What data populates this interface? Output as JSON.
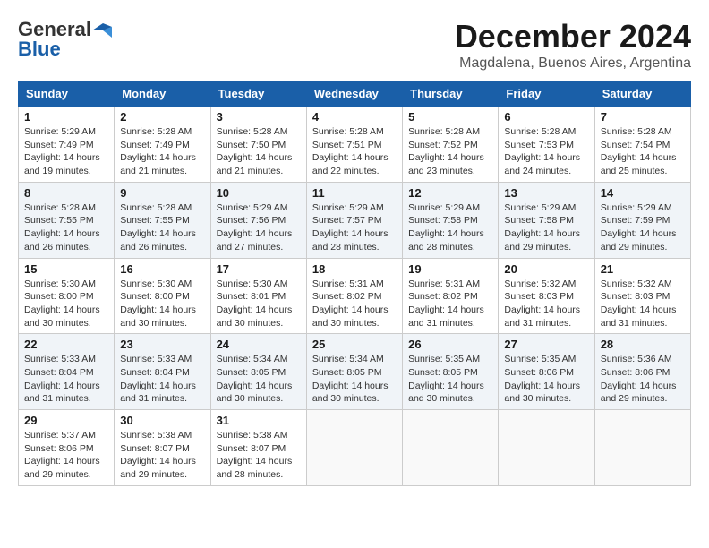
{
  "logo": {
    "general": "General",
    "blue": "Blue"
  },
  "title": {
    "month": "December 2024",
    "location": "Magdalena, Buenos Aires, Argentina"
  },
  "weekdays": [
    "Sunday",
    "Monday",
    "Tuesday",
    "Wednesday",
    "Thursday",
    "Friday",
    "Saturday"
  ],
  "weeks": [
    [
      {
        "day": "1",
        "info": "Sunrise: 5:29 AM\nSunset: 7:49 PM\nDaylight: 14 hours\nand 19 minutes."
      },
      {
        "day": "2",
        "info": "Sunrise: 5:28 AM\nSunset: 7:49 PM\nDaylight: 14 hours\nand 21 minutes."
      },
      {
        "day": "3",
        "info": "Sunrise: 5:28 AM\nSunset: 7:50 PM\nDaylight: 14 hours\nand 21 minutes."
      },
      {
        "day": "4",
        "info": "Sunrise: 5:28 AM\nSunset: 7:51 PM\nDaylight: 14 hours\nand 22 minutes."
      },
      {
        "day": "5",
        "info": "Sunrise: 5:28 AM\nSunset: 7:52 PM\nDaylight: 14 hours\nand 23 minutes."
      },
      {
        "day": "6",
        "info": "Sunrise: 5:28 AM\nSunset: 7:53 PM\nDaylight: 14 hours\nand 24 minutes."
      },
      {
        "day": "7",
        "info": "Sunrise: 5:28 AM\nSunset: 7:54 PM\nDaylight: 14 hours\nand 25 minutes."
      }
    ],
    [
      {
        "day": "8",
        "info": "Sunrise: 5:28 AM\nSunset: 7:55 PM\nDaylight: 14 hours\nand 26 minutes."
      },
      {
        "day": "9",
        "info": "Sunrise: 5:28 AM\nSunset: 7:55 PM\nDaylight: 14 hours\nand 26 minutes."
      },
      {
        "day": "10",
        "info": "Sunrise: 5:29 AM\nSunset: 7:56 PM\nDaylight: 14 hours\nand 27 minutes."
      },
      {
        "day": "11",
        "info": "Sunrise: 5:29 AM\nSunset: 7:57 PM\nDaylight: 14 hours\nand 28 minutes."
      },
      {
        "day": "12",
        "info": "Sunrise: 5:29 AM\nSunset: 7:58 PM\nDaylight: 14 hours\nand 28 minutes."
      },
      {
        "day": "13",
        "info": "Sunrise: 5:29 AM\nSunset: 7:58 PM\nDaylight: 14 hours\nand 29 minutes."
      },
      {
        "day": "14",
        "info": "Sunrise: 5:29 AM\nSunset: 7:59 PM\nDaylight: 14 hours\nand 29 minutes."
      }
    ],
    [
      {
        "day": "15",
        "info": "Sunrise: 5:30 AM\nSunset: 8:00 PM\nDaylight: 14 hours\nand 30 minutes."
      },
      {
        "day": "16",
        "info": "Sunrise: 5:30 AM\nSunset: 8:00 PM\nDaylight: 14 hours\nand 30 minutes."
      },
      {
        "day": "17",
        "info": "Sunrise: 5:30 AM\nSunset: 8:01 PM\nDaylight: 14 hours\nand 30 minutes."
      },
      {
        "day": "18",
        "info": "Sunrise: 5:31 AM\nSunset: 8:02 PM\nDaylight: 14 hours\nand 30 minutes."
      },
      {
        "day": "19",
        "info": "Sunrise: 5:31 AM\nSunset: 8:02 PM\nDaylight: 14 hours\nand 31 minutes."
      },
      {
        "day": "20",
        "info": "Sunrise: 5:32 AM\nSunset: 8:03 PM\nDaylight: 14 hours\nand 31 minutes."
      },
      {
        "day": "21",
        "info": "Sunrise: 5:32 AM\nSunset: 8:03 PM\nDaylight: 14 hours\nand 31 minutes."
      }
    ],
    [
      {
        "day": "22",
        "info": "Sunrise: 5:33 AM\nSunset: 8:04 PM\nDaylight: 14 hours\nand 31 minutes."
      },
      {
        "day": "23",
        "info": "Sunrise: 5:33 AM\nSunset: 8:04 PM\nDaylight: 14 hours\nand 31 minutes."
      },
      {
        "day": "24",
        "info": "Sunrise: 5:34 AM\nSunset: 8:05 PM\nDaylight: 14 hours\nand 30 minutes."
      },
      {
        "day": "25",
        "info": "Sunrise: 5:34 AM\nSunset: 8:05 PM\nDaylight: 14 hours\nand 30 minutes."
      },
      {
        "day": "26",
        "info": "Sunrise: 5:35 AM\nSunset: 8:05 PM\nDaylight: 14 hours\nand 30 minutes."
      },
      {
        "day": "27",
        "info": "Sunrise: 5:35 AM\nSunset: 8:06 PM\nDaylight: 14 hours\nand 30 minutes."
      },
      {
        "day": "28",
        "info": "Sunrise: 5:36 AM\nSunset: 8:06 PM\nDaylight: 14 hours\nand 29 minutes."
      }
    ],
    [
      {
        "day": "29",
        "info": "Sunrise: 5:37 AM\nSunset: 8:06 PM\nDaylight: 14 hours\nand 29 minutes."
      },
      {
        "day": "30",
        "info": "Sunrise: 5:38 AM\nSunset: 8:07 PM\nDaylight: 14 hours\nand 29 minutes."
      },
      {
        "day": "31",
        "info": "Sunrise: 5:38 AM\nSunset: 8:07 PM\nDaylight: 14 hours\nand 28 minutes."
      },
      {
        "day": "",
        "info": ""
      },
      {
        "day": "",
        "info": ""
      },
      {
        "day": "",
        "info": ""
      },
      {
        "day": "",
        "info": ""
      }
    ]
  ]
}
